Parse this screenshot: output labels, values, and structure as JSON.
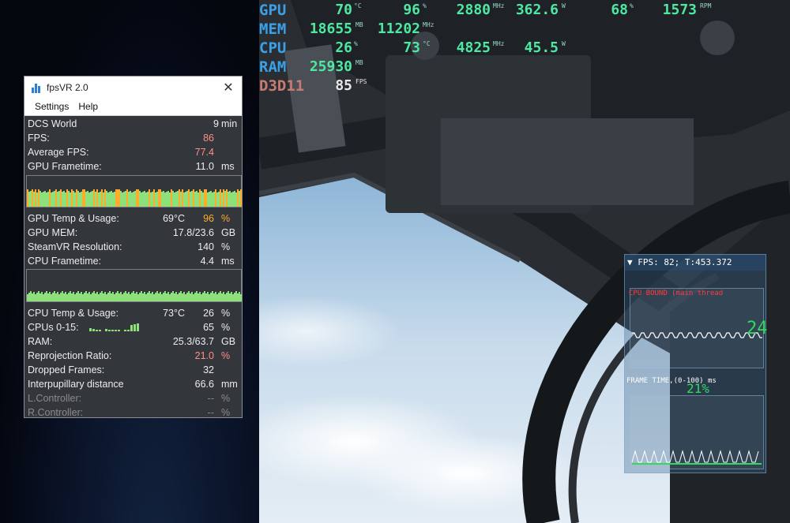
{
  "window": {
    "title": "fpsVR 2.0",
    "menu": [
      "Settings",
      "Help"
    ]
  },
  "stats": {
    "app_name": "DCS World",
    "app_time": "9",
    "app_time_unit": "min",
    "fps_label": "FPS:",
    "fps": "86",
    "avg_fps_label": "Average FPS:",
    "avg_fps": "77.4",
    "gpu_ft_label": "GPU Frametime:",
    "gpu_ft": "11.0",
    "gpu_ft_unit": "ms",
    "gpu_temp_label": "GPU Temp & Usage:",
    "gpu_temp": "69°C",
    "gpu_usage": "96",
    "pct": "%",
    "gpu_mem_label": "GPU MEM:",
    "gpu_mem": "17.8/23.6",
    "gpu_mem_unit": "GB",
    "steamvr_label": "SteamVR Resolution:",
    "steamvr": "140",
    "cpu_ft_label": "CPU Frametime:",
    "cpu_ft": "4.4",
    "cpu_ft_unit": "ms",
    "cpu_temp_label": "CPU Temp & Usage:",
    "cpu_temp": "73°C",
    "cpu_usage": "26",
    "cpus_label": "CPUs 0-15:",
    "cpus": "65",
    "ram_label": "RAM:",
    "ram": "25.3/63.7",
    "ram_unit": "GB",
    "reproj_label": "Reprojection Ratio:",
    "reproj": "21.0",
    "dropped_label": "Dropped Frames:",
    "dropped": "32",
    "ipd_label": "Interpupillary distance",
    "ipd": "66.6",
    "ipd_unit": "mm",
    "lctrl_label": "L.Controller:",
    "lctrl": "--",
    "rctrl_label": "R.Controller:",
    "rctrl": "--"
  },
  "osd": {
    "gpu": {
      "label": "GPU",
      "temp": "70",
      "temp_unit": "°C",
      "usage": "96",
      "usage_unit": "%",
      "clock": "2880",
      "clock_unit": "MHz",
      "power": "362.6",
      "power_unit": "W",
      "fan": "68",
      "fan_unit": "%",
      "rpm": "1573",
      "rpm_unit": "RPM"
    },
    "mem": {
      "label": "MEM",
      "used": "18655",
      "used_unit": "MB",
      "clock": "11202",
      "clock_unit": "MHz"
    },
    "cpu": {
      "label": "CPU",
      "usage": "26",
      "usage_unit": "%",
      "temp": "73",
      "temp_unit": "°C",
      "clock": "4825",
      "clock_unit": "MHz",
      "power": "45.5",
      "power_unit": "W"
    },
    "ram": {
      "label": "RAM",
      "used": "25930",
      "used_unit": "MB"
    },
    "api": {
      "label": "D3D11",
      "fps": "85",
      "fps_unit": "FPS"
    }
  },
  "overlay": {
    "header": "▼ FPS: 82; T:453.372",
    "cpu_bound": "CPU BOUND (main thread",
    "frame_time": "FRAME TIME,(0-100) ms",
    "percent": "21%",
    "hud_number": "24"
  },
  "colors": {
    "osd_label_blue": "#3aa0e8",
    "osd_label_red": "#c97a72",
    "osd_value_green": "#4ee8a2",
    "warn_red": "#ff8f86",
    "warn_orange": "#ffab2e",
    "graph_green": "#8ee07a"
  }
}
